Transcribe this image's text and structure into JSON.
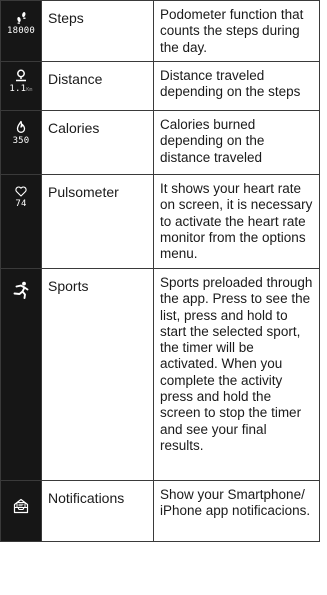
{
  "rows": [
    {
      "icon": "footprints-icon",
      "value": "18000",
      "name": "Steps",
      "description": "Podometer function that counts the steps during the day."
    },
    {
      "icon": "location-pin-icon",
      "value": "1.1",
      "unit": "Km",
      "name": "Distance",
      "description": "Distance traveled depending on the steps"
    },
    {
      "icon": "flame-icon",
      "value": "350",
      "name": "Calories",
      "description": "Calories burned depending on the distance traveled"
    },
    {
      "icon": "heart-icon",
      "value": "74",
      "name": "Pulsometer",
      "description": "It shows your heart rate on screen, it is necessary to activate the heart rate monitor from the options menu."
    },
    {
      "icon": "running-person-icon",
      "name": "Sports",
      "description": "Sports preloaded through the app. Press to see the list, press and hold to start the selected sport, the timer will be activated. When you complete the activity press and hold the screen to stop the timer and see your final results."
    },
    {
      "icon": "notification-tray-icon",
      "name": "Notifications",
      "description": "Show your Smartphone/ iPhone app notificacions."
    }
  ]
}
